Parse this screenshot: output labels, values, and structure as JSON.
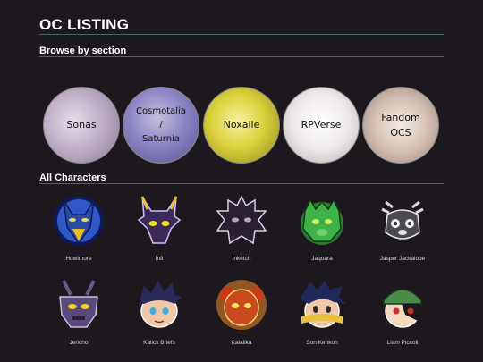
{
  "page": {
    "title": "OC LISTING"
  },
  "browse": {
    "heading": "Browse by section",
    "sections": [
      {
        "label": "Sonas",
        "icon": "sonas-section-thumb"
      },
      {
        "label": "Cosmotalia / Saturnia",
        "icon": "cosmotalia-section-thumb"
      },
      {
        "label": "Noxalle",
        "icon": "noxalle-section-thumb"
      },
      {
        "label": "RPVerse",
        "icon": "rpverse-section-thumb"
      },
      {
        "label": "Fandom OCS",
        "icon": "fandom-section-thumb"
      }
    ]
  },
  "characters": {
    "heading": "All Characters",
    "items": [
      {
        "name": "Howlmore",
        "icon": "howlmore-avatar",
        "color": "#3158c8"
      },
      {
        "name": "Infi",
        "icon": "infi-avatar",
        "color": "#3a2a55"
      },
      {
        "name": "Inketch",
        "icon": "inketch-avatar",
        "color": "#2a1f30"
      },
      {
        "name": "Jaquara",
        "icon": "jaquara-avatar",
        "color": "#3fb24a"
      },
      {
        "name": "Jasper Jackalope",
        "icon": "jasper-jackalope-avatar",
        "color": "#4a4a52"
      },
      {
        "name": "Jericho",
        "icon": "jericho-avatar",
        "color": "#5a4a7a"
      },
      {
        "name": "Kalick Briefs",
        "icon": "kalick-briefs-avatar",
        "color": "#2a2a58"
      },
      {
        "name": "Kalalika",
        "icon": "kalalika-avatar",
        "color": "#c84a1e"
      },
      {
        "name": "Son Kenkoh",
        "icon": "son-kenkoh-avatar",
        "color": "#1f2a5a"
      },
      {
        "name": "Liam Piccoli",
        "icon": "liam-piccoli-avatar",
        "color": "#4a8a4a"
      }
    ]
  }
}
